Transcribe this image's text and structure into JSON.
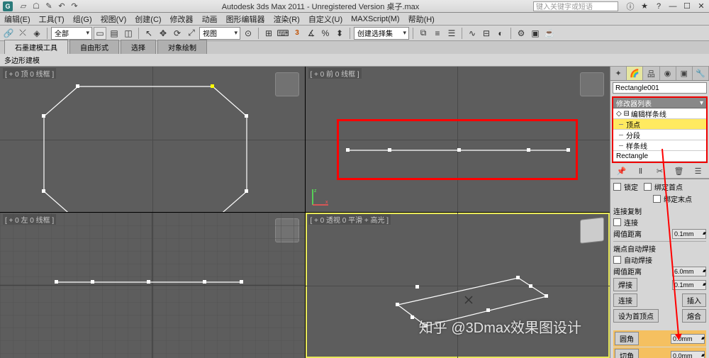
{
  "title": "Autodesk 3ds Max 2011 - Unregistered Version   桌子.max",
  "search_placeholder": "键入关键字或短语",
  "menus": [
    "编辑(E)",
    "工具(T)",
    "组(G)",
    "视图(V)",
    "创建(C)",
    "修改器",
    "动画",
    "图形编辑器",
    "渲染(R)",
    "自定义(U)",
    "MAXScript(M)",
    "帮助(H)"
  ],
  "toolbar": {
    "selset_combo": "全部",
    "view_combo": "视图",
    "createsel_combo": "创建选择集"
  },
  "ribbon_tabs": [
    "石墨建模工具",
    "自由形式",
    "选择",
    "对象绘制"
  ],
  "ribbon_panel": "多边形建模",
  "viewports": {
    "tl": "[ + 0 顶 0 线框 ]",
    "tr": "[ + 0 前 0 线框 ]",
    "bl": "[ + 0 左 0 线框 ]",
    "br": "[ + 0 透视 0 平滑 + 高光 ]"
  },
  "cmdpanel": {
    "obj_name": "Rectangle001",
    "mod_header": "修改器列表",
    "stack": {
      "edit_spline": "编辑样条线",
      "vertex": "顶点",
      "segment": "分段",
      "spline": "样条线",
      "base": "Rectangle"
    },
    "params": {
      "lock_label": "锁定",
      "bind_first": "绑定首点",
      "bind_last": "绑定末点",
      "conn_copy": "连接复制",
      "connect": "连接",
      "threshold_lbl": "阈值距离",
      "threshold_val": "0.1mm",
      "auto_weld_hdr": "端点自动焊接",
      "auto_weld": "自动焊接",
      "weld_thresh_lbl": "阈值距离",
      "weld_thresh_val": "6.0mm",
      "weld_btn": "焊接",
      "weld_val": "0.1mm",
      "connect_btn": "连接",
      "insert_btn": "插入",
      "make_first": "设为首顶点",
      "fuse_btn": "熔合",
      "fillet_lbl": "圆角",
      "fillet_val": "0.0mm",
      "chamfer_lbl": "切角",
      "chamfer_val": "0.0mm"
    }
  },
  "watermark": "知乎 @3Dmax效果图设计"
}
